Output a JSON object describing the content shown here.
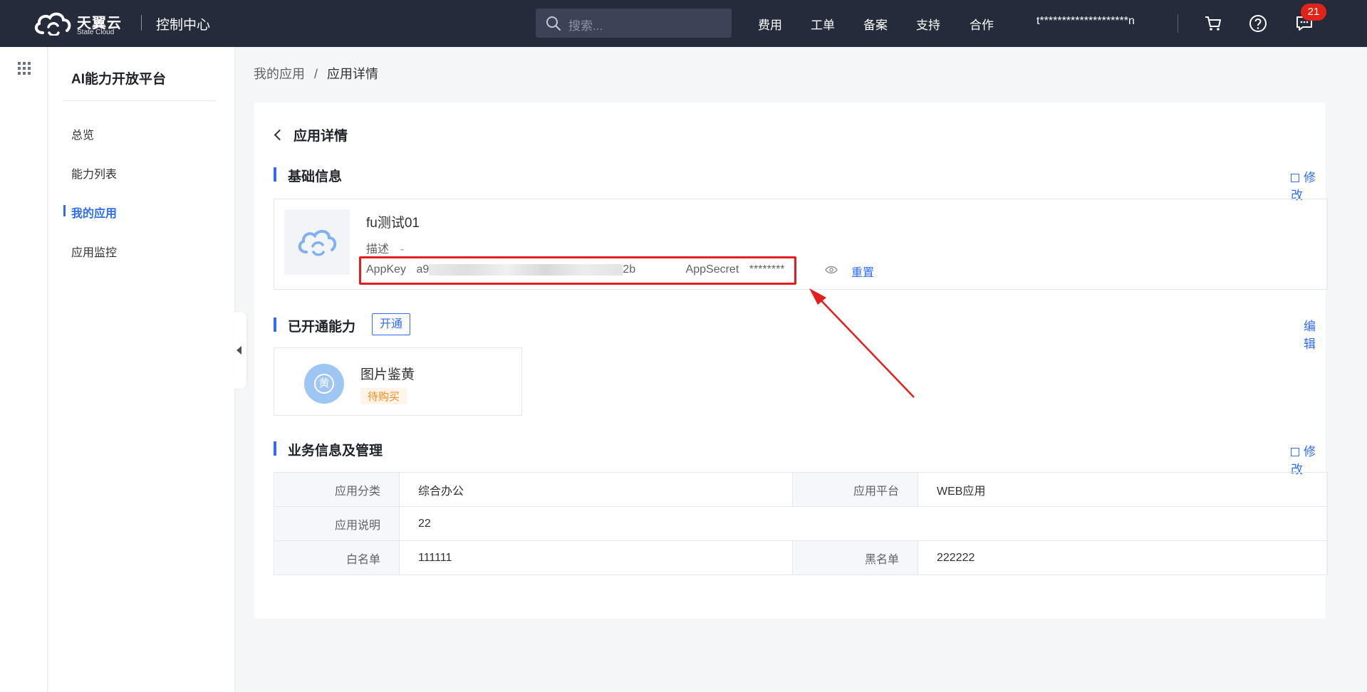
{
  "header": {
    "brand_cn": "天翼云",
    "brand_en": "State Cloud",
    "console_title": "控制中心",
    "search_placeholder": "搜索...",
    "nav": [
      "费用",
      "工单",
      "备案",
      "支持",
      "合作"
    ],
    "account": "t********************n",
    "message_count": "21"
  },
  "sidebar": {
    "title": "AI能力开放平台",
    "items": [
      {
        "label": "总览",
        "active": false
      },
      {
        "label": "能力列表",
        "active": false
      },
      {
        "label": "我的应用",
        "active": true
      },
      {
        "label": "应用监控",
        "active": false
      }
    ]
  },
  "breadcrumb": {
    "parent": "我的应用",
    "separator": "/",
    "current": "应用详情"
  },
  "page": {
    "back_title": "应用详情",
    "basic": {
      "section_title": "基础信息",
      "edit_label": "修改",
      "app_name": "fu测试01",
      "desc_label": "描述",
      "desc_value": "-",
      "appkey_label": "AppKey",
      "appkey_prefix": "a9",
      "appkey_suffix": "2b",
      "appsecret_label": "AppSecret",
      "appsecret_value": "********",
      "reset_label": "重置"
    },
    "capabilities": {
      "section_title": "已开通能力",
      "open_tag": "开通",
      "edit_label": "编辑",
      "items": [
        {
          "name": "图片鉴黄",
          "status": "待购买",
          "icon_glyph": "黄"
        }
      ]
    },
    "business": {
      "section_title": "业务信息及管理",
      "edit_label": "修改",
      "rows": [
        {
          "label1": "应用分类",
          "value1": "综合办公",
          "label2": "应用平台",
          "value2": "WEB应用"
        },
        {
          "label1": "应用说明",
          "value1": "22"
        },
        {
          "label1": "白名单",
          "value1": "111111",
          "label2": "黑名单",
          "value2": "222222"
        }
      ]
    }
  },
  "colors": {
    "accent": "#2f6df6",
    "topbar": "#252b3a",
    "highlight": "#e41e1e",
    "pending": "#ff8a1f"
  }
}
